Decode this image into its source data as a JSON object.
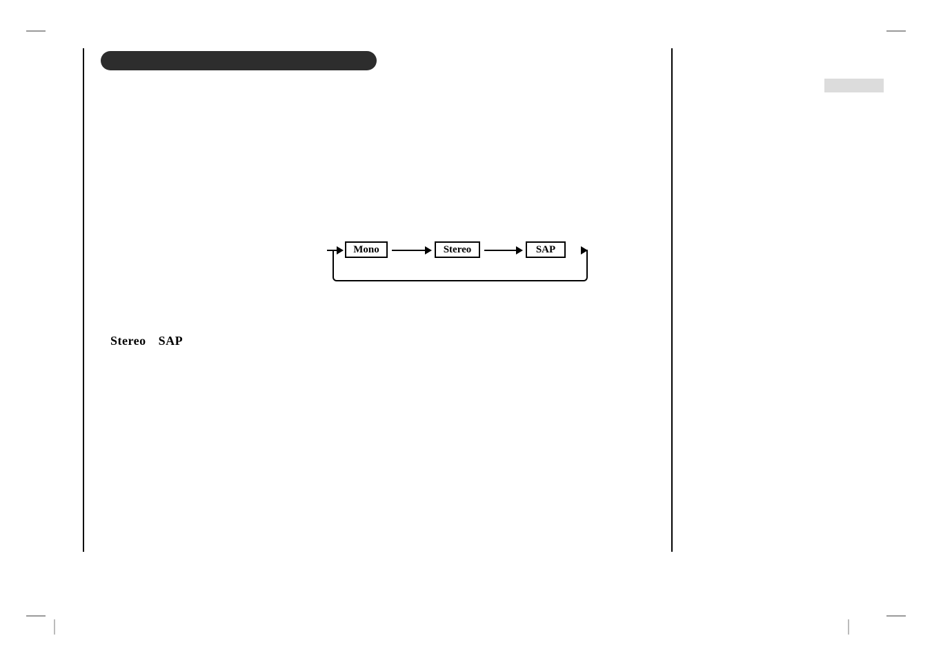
{
  "diagram": {
    "modes": [
      "Mono",
      "Stereo",
      "SAP"
    ]
  },
  "labels": {
    "stereo": "Stereo",
    "sap": "SAP"
  }
}
